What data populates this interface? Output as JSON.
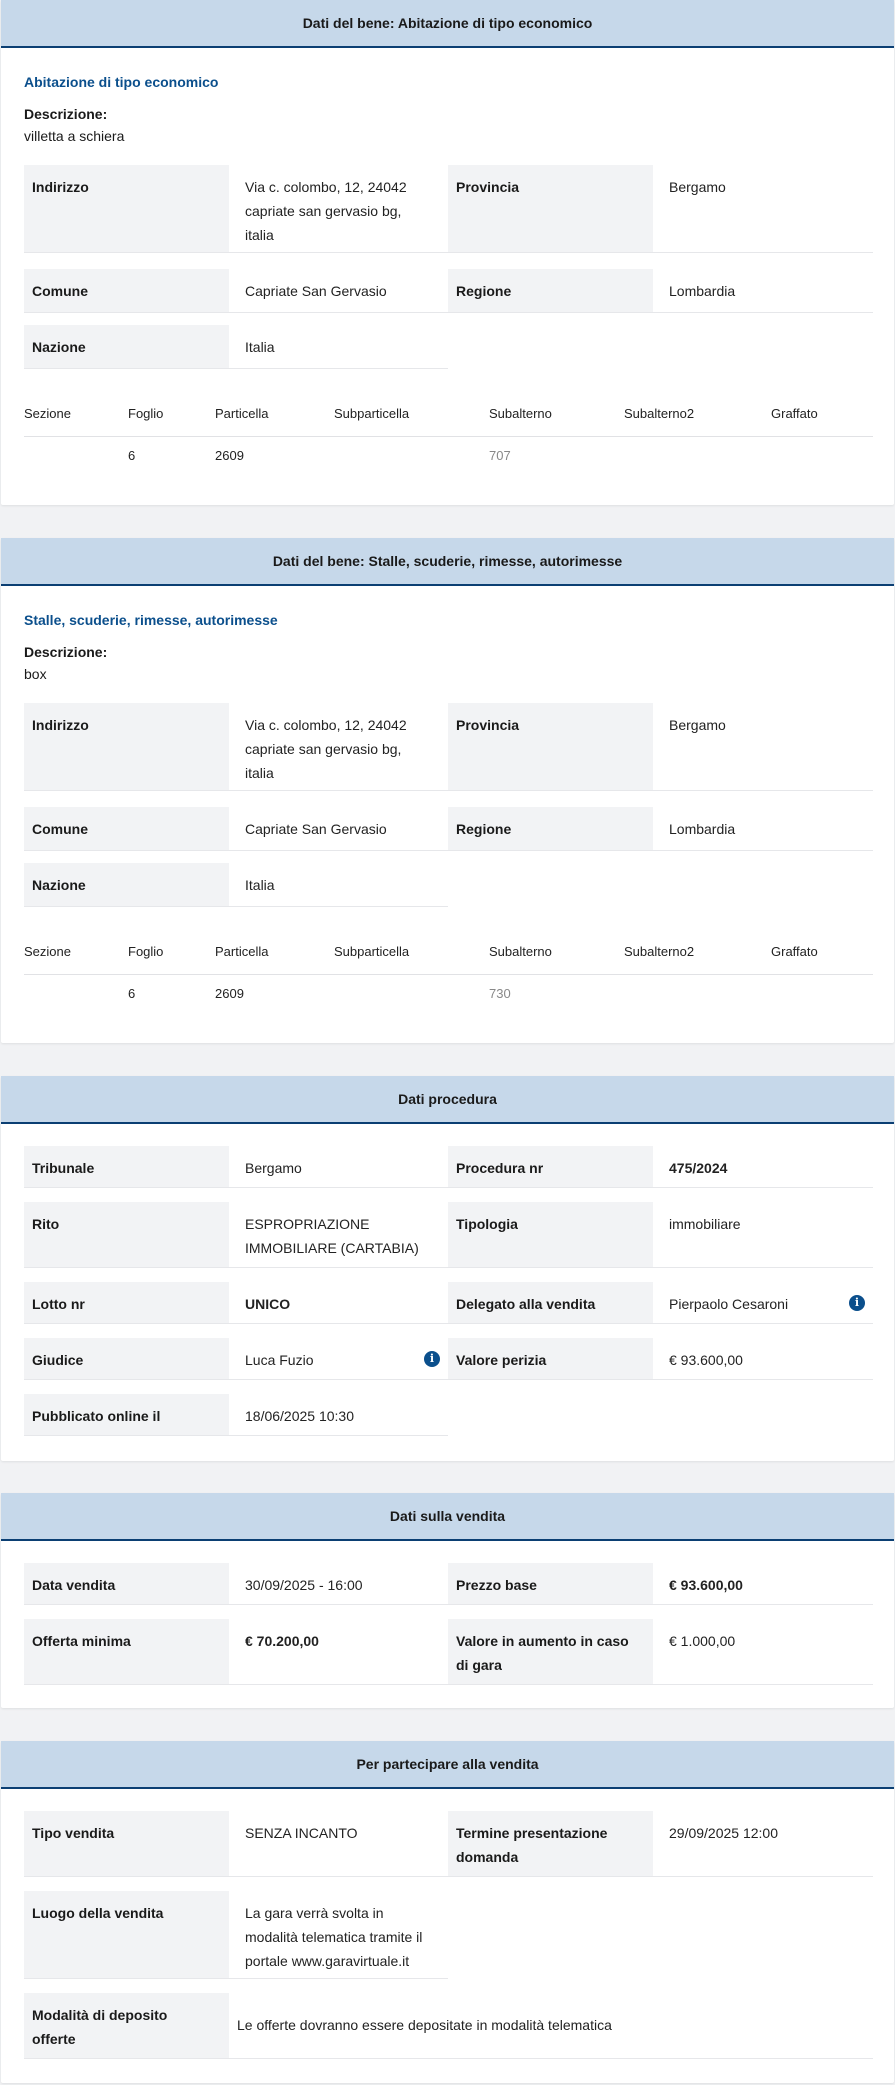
{
  "bene1": {
    "header": "Dati del bene: Abitazione di tipo economico",
    "subtitle": "Abitazione di tipo economico",
    "descrizione_label": "Descrizione:",
    "descrizione": "villetta a schiera",
    "indirizzo_label": "Indirizzo",
    "indirizzo": [
      "Via c. colombo, 12, 24042",
      "capriate san gervasio bg,",
      "italia"
    ],
    "provincia_label": "Provincia",
    "provincia": "Bergamo",
    "comune_label": "Comune",
    "comune": "Capriate San Gervasio",
    "regione_label": "Regione",
    "regione": "Lombardia",
    "nazione_label": "Nazione",
    "nazione": "Italia",
    "catasto_headers": [
      "Sezione",
      "Foglio",
      "Particella",
      "Subparticella",
      "Subalterno",
      "Subalterno2",
      "Graffato"
    ],
    "catasto_row": [
      "",
      "6",
      "2609",
      "",
      "707",
      "",
      ""
    ]
  },
  "bene2": {
    "header": "Dati del bene: Stalle, scuderie, rimesse, autorimesse",
    "subtitle": "Stalle, scuderie, rimesse, autorimesse",
    "descrizione_label": "Descrizione:",
    "descrizione": "box",
    "indirizzo_label": "Indirizzo",
    "indirizzo": [
      "Via c. colombo, 12, 24042",
      "capriate san gervasio bg,",
      "italia"
    ],
    "provincia_label": "Provincia",
    "provincia": "Bergamo",
    "comune_label": "Comune",
    "comune": "Capriate San Gervasio",
    "regione_label": "Regione",
    "regione": "Lombardia",
    "nazione_label": "Nazione",
    "nazione": "Italia",
    "catasto_headers": [
      "Sezione",
      "Foglio",
      "Particella",
      "Subparticella",
      "Subalterno",
      "Subalterno2",
      "Graffato"
    ],
    "catasto_row": [
      "",
      "6",
      "2609",
      "",
      "730",
      "",
      ""
    ]
  },
  "procedura": {
    "header": "Dati procedura",
    "tribunale_label": "Tribunale",
    "tribunale": "Bergamo",
    "procedura_label": "Procedura nr",
    "procedura": "475/2024",
    "rito_label": "Rito",
    "rito": [
      "ESPROPRIAZIONE",
      "IMMOBILIARE (CARTABIA)"
    ],
    "tipologia_label": "Tipologia",
    "tipologia": "immobiliare",
    "lotto_label": "Lotto nr",
    "lotto": "UNICO",
    "delegato_label": "Delegato alla vendita",
    "delegato": "Pierpaolo Cesaroni",
    "giudice_label": "Giudice",
    "giudice": "Luca Fuzio",
    "valore_label": "Valore perizia",
    "valore": "€ 93.600,00",
    "pubblicato_label": "Pubblicato online il",
    "pubblicato": "18/06/2025 10:30",
    "info_glyph": "i"
  },
  "vendita": {
    "header": "Dati sulla vendita",
    "data_label": "Data vendita",
    "data": "30/09/2025 - 16:00",
    "prezzo_label": "Prezzo base",
    "prezzo": "€ 93.600,00",
    "offerta_label": "Offerta minima",
    "offerta": "€ 70.200,00",
    "aumento_label": [
      "Valore in aumento in caso",
      "di gara"
    ],
    "aumento": "€ 1.000,00"
  },
  "partecipare": {
    "header": "Per partecipare alla vendita",
    "tipo_label": "Tipo vendita",
    "tipo": "SENZA INCANTO",
    "termine_label": [
      "Termine presentazione",
      "domanda"
    ],
    "termine": "29/09/2025 12:00",
    "luogo_label": "Luogo della vendita",
    "luogo": [
      "La gara verrà svolta in",
      "modalità telematica tramite il",
      "portale www.garavirtuale.it"
    ],
    "deposito_label": [
      "Modalità di deposito",
      "offerte"
    ],
    "deposito": "Le offerte dovranno essere depositate in modalità telematica"
  },
  "colors": {
    "header_bg": "#c6d8ea",
    "header_border": "#0b3f73",
    "subtitle": "#0b4f8c",
    "label_bg": "#f2f3f5",
    "page_bg": "#f1f2f4"
  }
}
